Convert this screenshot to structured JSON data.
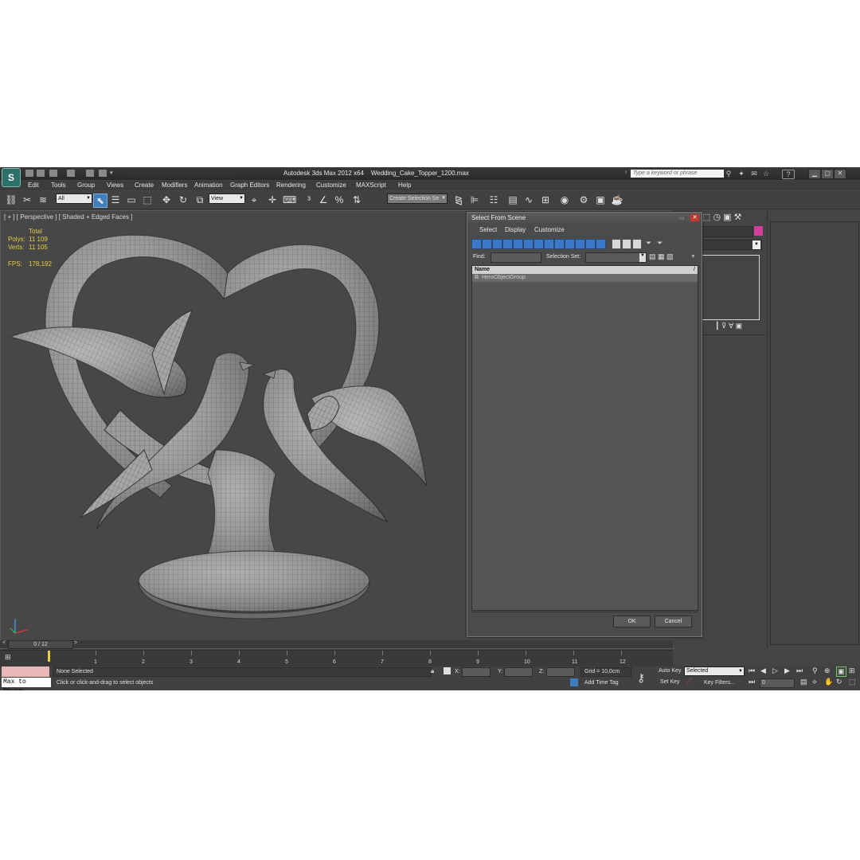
{
  "window": {
    "app_title": "Autodesk 3ds Max  2012 x64",
    "file_name": "Wedding_Cake_Topper_1200.max",
    "search_placeholder": "Type a keyword or phrase",
    "logo": "3ds-max-logo"
  },
  "menu": [
    "Edit",
    "Tools",
    "Group",
    "Views",
    "Create",
    "Modifiers",
    "Animation",
    "Graph Editors",
    "Rendering",
    "Customize",
    "MAXScript",
    "Help"
  ],
  "toolbar": {
    "filter_value": "All",
    "refcoord_value": "View",
    "selection_set_placeholder": "Create Selection Se"
  },
  "viewport": {
    "label": "[ + ] [ Perspective ] [ Shaded + Edged Faces ]",
    "stats": {
      "total_label": "Total",
      "polys_label": "Polys:",
      "polys_value": "11 109",
      "verts_label": "Verts:",
      "verts_value": "11 105",
      "fps_label": "FPS:",
      "fps_value": "178,192"
    },
    "model": "wedding-cake-topper-doves-heart"
  },
  "dialog": {
    "title": "Select From Scene",
    "menu": [
      "Select",
      "Display",
      "Customize"
    ],
    "find_label": "Find:",
    "selection_set_label": "Selection Set:",
    "column_name": "Name",
    "rows": [
      "HeroObjectGroup"
    ],
    "ok_label": "OK",
    "cancel_label": "Cancel"
  },
  "timeline": {
    "frame_display": "0 / 12",
    "ticks": [
      "1",
      "2",
      "3",
      "4",
      "5",
      "6",
      "7",
      "8",
      "9",
      "10",
      "11",
      "12"
    ],
    "current_frame": 0,
    "total_frames": 12
  },
  "status": {
    "selection": "None Selected",
    "prompt": "Click or click-and-drag to select objects",
    "maxscript_text": "Max to Physc.",
    "x_label": "X:",
    "y_label": "Y:",
    "z_label": "Z:",
    "grid": "Grid = 10,0cm",
    "add_time_tag": "Add Time Tag",
    "auto_key": "Auto Key",
    "set_key": "Set Key",
    "selected_value": "Selected",
    "key_filters": "Key Filters...",
    "frame_value": "0"
  },
  "colors": {
    "accent": "#3f7fbf",
    "stat_yellow": "#e8cc44",
    "swatch": "#d43d9a"
  }
}
